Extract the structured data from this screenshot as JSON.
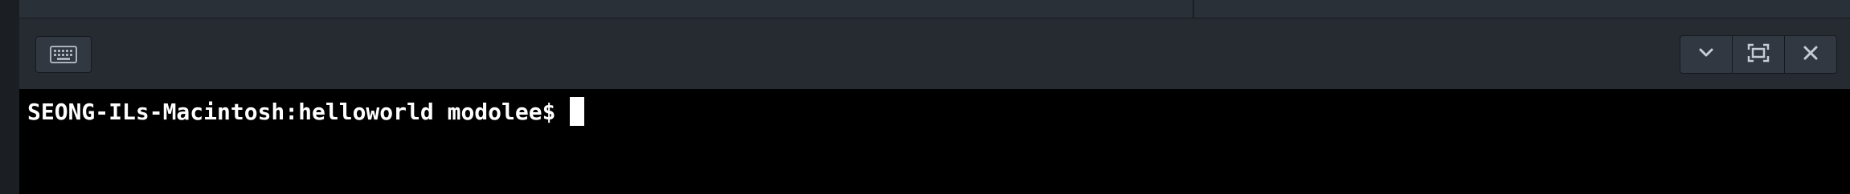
{
  "terminal": {
    "prompt": "SEONG-ILs-Macintosh:helloworld modolee$"
  },
  "toolbar": {
    "left_icons": [
      "keyboard-icon"
    ],
    "right_icons": [
      "chevron-down-icon",
      "maximize-icon",
      "close-icon"
    ]
  },
  "colors": {
    "terminal_background": "#000000",
    "terminal_text": "#ffffff",
    "toolbar_background": "#262b32",
    "button_background": "#323841"
  }
}
